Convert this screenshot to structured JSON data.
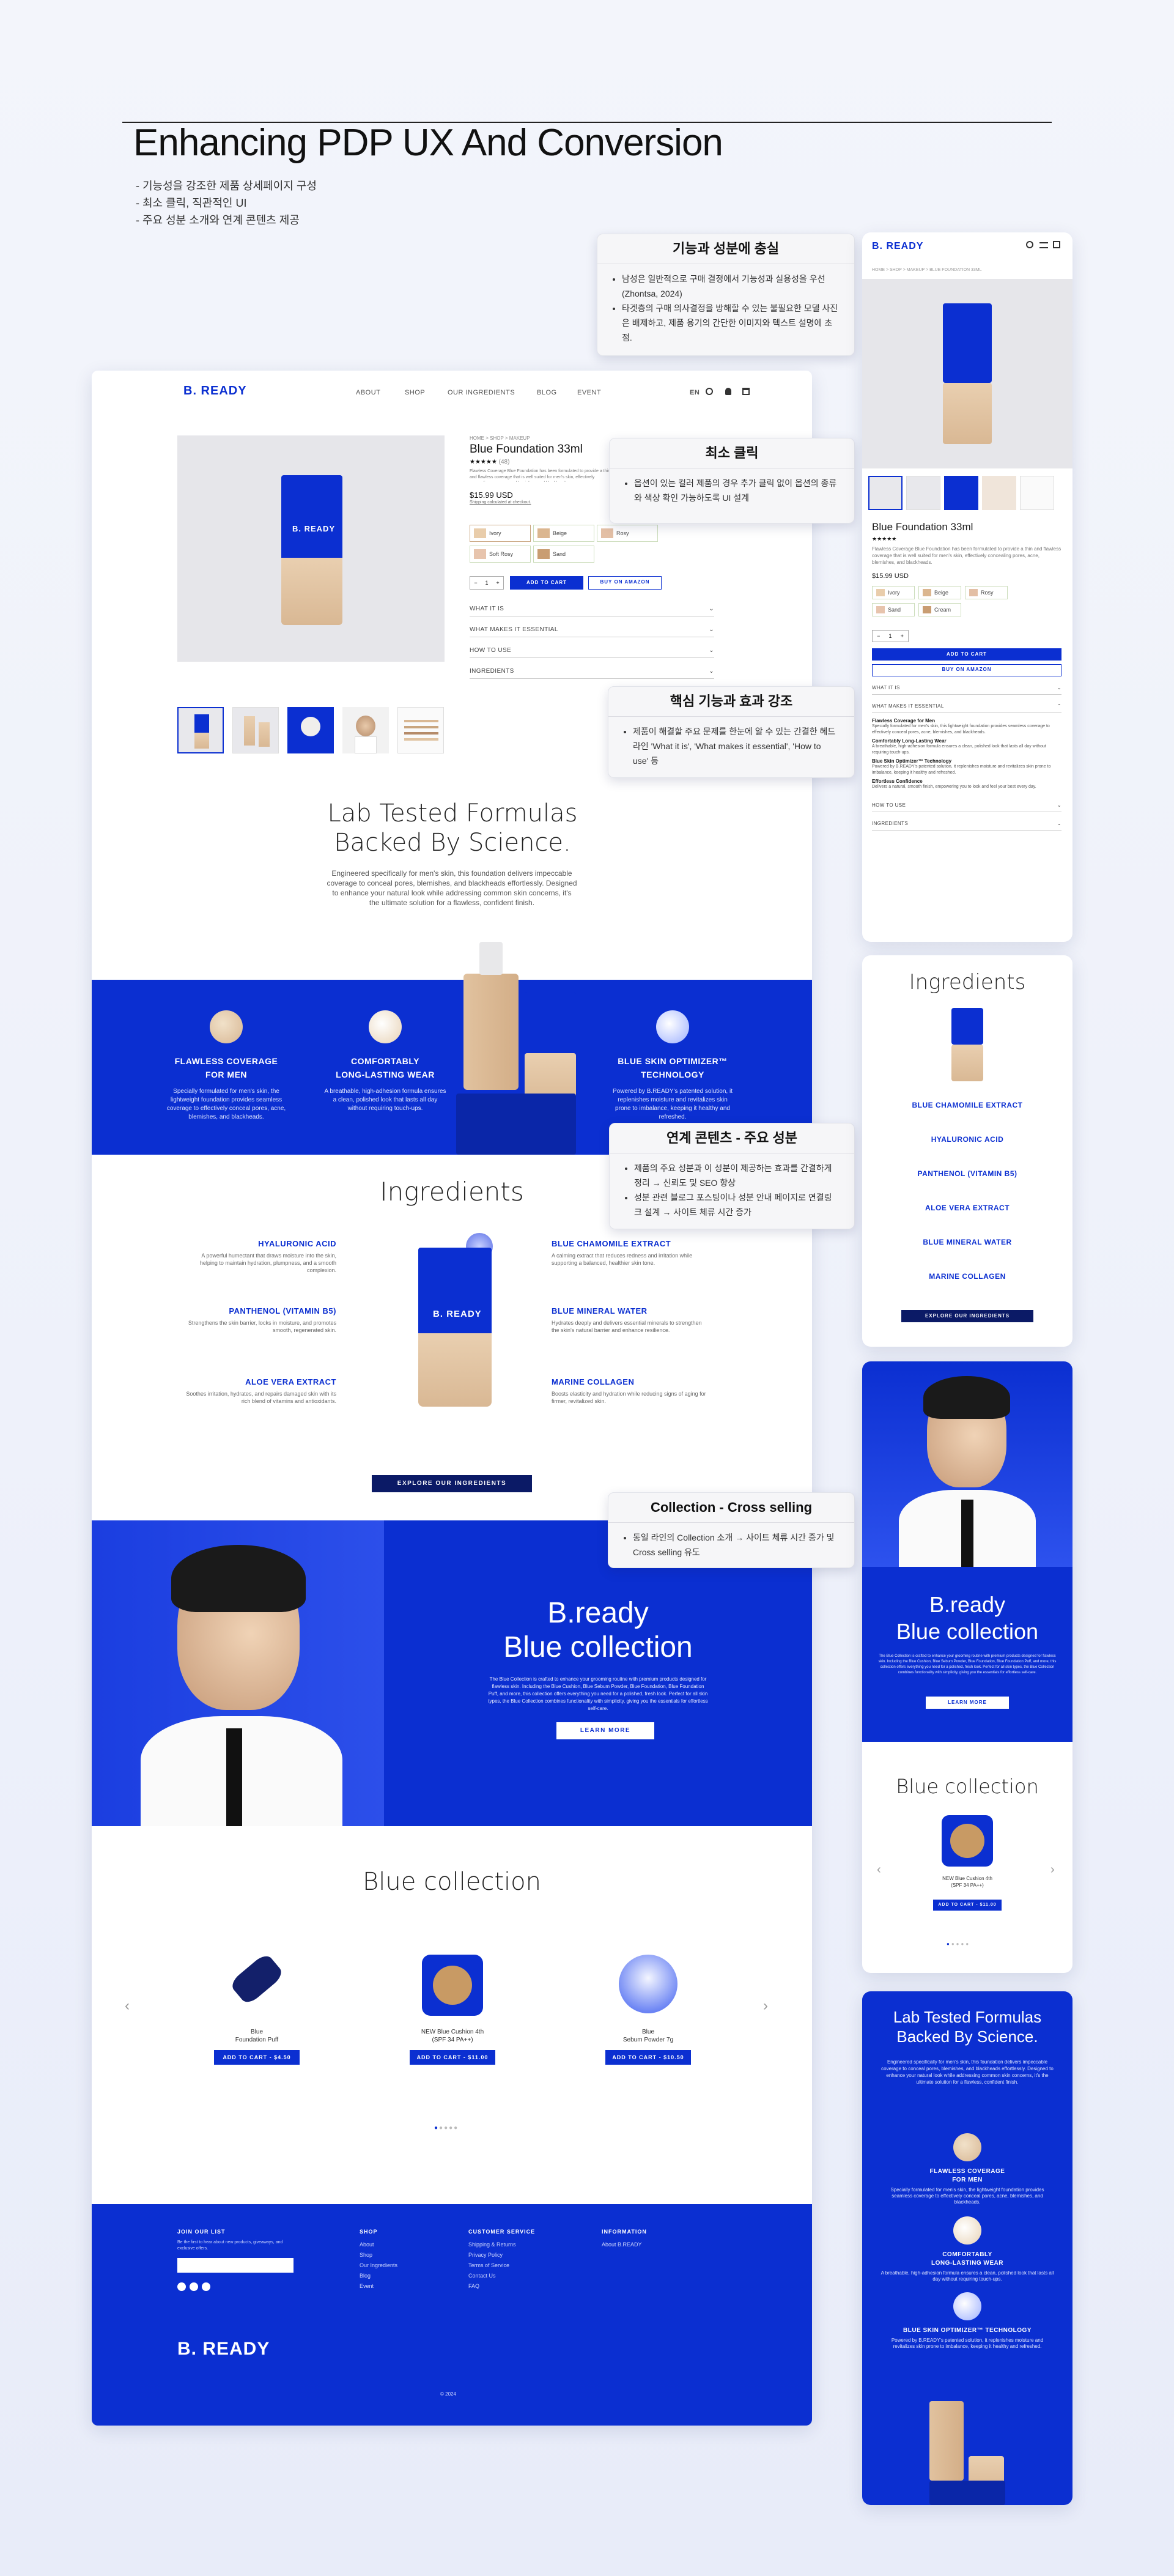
{
  "header": {
    "title": "Enhancing PDP UX And Conversion",
    "bullets": [
      "- 기능성을 강조한 제품 상세페이지 구성",
      "- 최소 클릭, 직관적인 UI",
      "- 주요 성분 소개와 연계 콘텐츠 제공"
    ]
  },
  "callouts": {
    "c1_title": "기능과 성분에 충실",
    "c1_b1": "남성은 일반적으로 구매 결정에서 기능성과 실용성을 우선(Zhontsa, 2024)",
    "c1_b2": "타겟층의 구매 의사결정을 방해할 수 있는 불필요한 모델 사진은 배제하고, 제품 용기의 간단한 이미지와 텍스트 설명에 초점.",
    "c2_title": "최소 클릭",
    "c2_b1": "옵션이 있는 컬러 제품의 경우 추가 클릭 없이 옵션의 종류와 색상 확인 가능하도록 UI 설계",
    "c3_title": "핵심 기능과 효과 강조",
    "c3_b1": "제품이 해결할 주요 문제를 한눈에 알 수 있는 간결한 헤드라인 'What it is', 'What makes it essential', 'How to use' 등",
    "c4_title": "연계 콘텐츠 - 주요 성분",
    "c4_b1": "제품의 주요 성분과 이 성분이 제공하는 효과를 간결하게 정리 → 신뢰도 및 SEO 향상",
    "c4_b2": "성분 관련 블로그 포스팅이나 성분 안내 페이지로 연결링크 설계 → 사이트 체류 시간 증가",
    "c5_title": "Collection - Cross selling",
    "c5_b1": "동일 라인의 Collection 소개 → 사이트 체류 시간 증가 및 Cross selling 유도"
  },
  "desktop": {
    "logo": "B. READY",
    "nav": [
      "ABOUT",
      "SHOP",
      "OUR INGREDIENTS",
      "BLOG",
      "EVENT"
    ],
    "lang": "EN",
    "breadcrumb": "HOME > SHOP > MAKEUP",
    "product_title": "Blue Foundation 33ml",
    "reviews": "(48)",
    "desc": "Flawless Coverage Blue Foundation has been formulated to provide a thin and flawless coverage that is well suited for men's skin, effectively concealing pores, acne, blemishes, and blackheads.",
    "price": "$15.99 USD",
    "shipping": "Shipping calculated at checkout.",
    "shades": [
      "Ivory",
      "Beige",
      "Rosy",
      "Soft Rosy",
      "Sand",
      "Cream"
    ],
    "qty": "1",
    "add_to_cart": "ADD TO CART",
    "buy_amazon": "BUY ON AMAZON",
    "accordions": [
      "WHAT IT IS",
      "WHAT MAKES IT ESSENTIAL",
      "HOW TO USE",
      "INGREDIENTS"
    ],
    "lab_title_1": "Lab Tested Formulas",
    "lab_title_2": "Backed By Science.",
    "lab_desc": "Engineered specifically for men's skin, this foundation delivers impeccable coverage to conceal pores, blemishes, and blackheads effortlessly. Designed to enhance your natural look while addressing common skin concerns, it's the ultimate solution for a flawless, confident finish.",
    "features": [
      {
        "title": "FLAWLESS COVERAGE\nFOR MEN",
        "desc": "Specially formulated for men's skin, the lightweight foundation provides seamless coverage to effectively conceal pores, acne, blemishes, and blackheads."
      },
      {
        "title": "COMFORTABLY\nLONG-LASTING WEAR",
        "desc": "A breathable, high-adhesion formula ensures a clean, polished look that lasts all day without requiring touch-ups."
      },
      {
        "title": "BLUE SKIN OPTIMIZER™\nTECHNOLOGY",
        "desc": "Powered by B.READY's patented solution, it replenishes moisture and revitalizes skin prone to imbalance, keeping it healthy and refreshed."
      }
    ],
    "ingredients_title": "Ingredients",
    "ingredients_left": [
      {
        "name": "HYALURONIC ACID",
        "desc": "A powerful humectant that draws moisture into the skin, helping to maintain hydration, plumpness, and a smooth complexion."
      },
      {
        "name": "PANTHENOL (VITAMIN B5)",
        "desc": "Strengthens the skin barrier, locks in moisture, and promotes smooth, regenerated skin."
      },
      {
        "name": "ALOE VERA EXTRACT",
        "desc": "Soothes irritation, hydrates, and repairs damaged skin with its rich blend of vitamins and antioxidants."
      }
    ],
    "ingredients_right": [
      {
        "name": "BLUE CHAMOMILE EXTRACT",
        "desc": "A calming extract that reduces redness and irritation while supporting a balanced, healthier skin tone."
      },
      {
        "name": "BLUE MINERAL WATER",
        "desc": "Hydrates deeply and delivers essential minerals to strengthen the skin's natural barrier and enhance resilience."
      },
      {
        "name": "MARINE COLLAGEN",
        "desc": "Boosts elasticity and hydration while reducing signs of aging for firmer, revitalized skin."
      }
    ],
    "explore": "EXPLORE OUR INGREDIENTS",
    "collection_title_1": "B.ready",
    "collection_title_2": "Blue collection",
    "collection_desc": "The Blue Collection is crafted to enhance your grooming routine with premium products designed for flawless skin. Including the Blue Cushion, Blue Sebum Powder, Blue Foundation, Blue Foundation Puff, and more, this collection offers everything you need for a polished, fresh look. Perfect for all skin types, the Blue Collection combines functionality with simplicity, giving you the essentials for effortless self-care.",
    "learn_more": "LEARN MORE",
    "carousel_title": "Blue collection",
    "products": [
      {
        "name": "Blue\nFoundation Puff",
        "btn": "ADD TO CART - $4.50"
      },
      {
        "name": "NEW Blue Cushion 4th\n(SPF 34 PA++)",
        "btn": "ADD TO CART - $11.00"
      },
      {
        "name": "Blue\nSebum Powder 7g",
        "btn": "ADD TO CART - $10.50"
      }
    ],
    "footer": {
      "join": "JOIN OUR LIST",
      "join_desc": "Be the first to hear about new products, giveaways, and exclusive offers.",
      "shop": "SHOP",
      "shop_items": [
        "About",
        "Shop",
        "Our Ingredients",
        "Blog",
        "Event"
      ],
      "cs": "CUSTOMER SERVICE",
      "cs_items": [
        "Shipping & Returns",
        "Privacy Policy",
        "Terms of Service",
        "Contact Us",
        "FAQ"
      ],
      "info": "INFORMATION",
      "info_items": [
        "About B.READY"
      ],
      "logo": "B. READY",
      "copyright": "© 2024"
    }
  },
  "mobile": {
    "logo": "B. READY",
    "breadcrumb": "HOME > SHOP > MAKEUP > BLUE FOUNDATION 33ML",
    "product_title": "Blue Foundation 33ml",
    "price": "$15.99 USD",
    "add_to_cart": "ADD TO CART",
    "buy_amazon": "BUY ON AMAZON",
    "acc1": "WHAT IT IS",
    "acc2": "WHAT MAKES IT ESSENTIAL",
    "essential": [
      {
        "h": "Flawless Coverage for Men",
        "p": "Specially formulated for men's skin, this lightweight foundation provides seamless coverage to effectively conceal pores, acne, blemishes, and blackheads."
      },
      {
        "h": "Comfortably Long-Lasting Wear",
        "p": "A breathable, high-adhesion formula ensures a clean, polished look that lasts all day without requiring touch-ups."
      },
      {
        "h": "Blue Skin Optimizer™ Technology",
        "p": "Powered by B.READY's patented solution, it replenishes moisture and revitalizes skin prone to imbalance, keeping it healthy and refreshed."
      },
      {
        "h": "Effortless Confidence",
        "p": "Delivers a natural, smooth finish, empowering you to look and feel your best every day."
      }
    ],
    "acc3": "HOW TO USE",
    "acc4": "INGREDIENTS",
    "ingredients_title": "Ingredients",
    "ingredients": [
      "BLUE CHAMOMILE EXTRACT",
      "HYALURONIC ACID",
      "PANTHENOL (VITAMIN B5)",
      "ALOE VERA EXTRACT",
      "BLUE MINERAL WATER",
      "MARINE COLLAGEN"
    ],
    "explore": "EXPLORE OUR INGREDIENTS",
    "coll_1": "B.ready",
    "coll_2": "Blue collection",
    "learn_more": "LEARN MORE",
    "carousel_title": "Blue collection",
    "cushion_name": "NEW Blue Cushion 4th\n(SPF 34 PA++)",
    "cushion_btn": "ADD TO CART - $11.00",
    "lab_1": "Lab Tested Formulas",
    "lab_2": "Backed By Science.",
    "feat1": "FLAWLESS COVERAGE\nFOR MEN",
    "feat2": "COMFORTABLY\nLONG-LASTING WEAR",
    "feat3": "BLUE SKIN OPTIMIZER™ TECHNOLOGY"
  },
  "colors": {
    "brand_blue": "#0b2fd1",
    "beige": "#d9b894"
  }
}
